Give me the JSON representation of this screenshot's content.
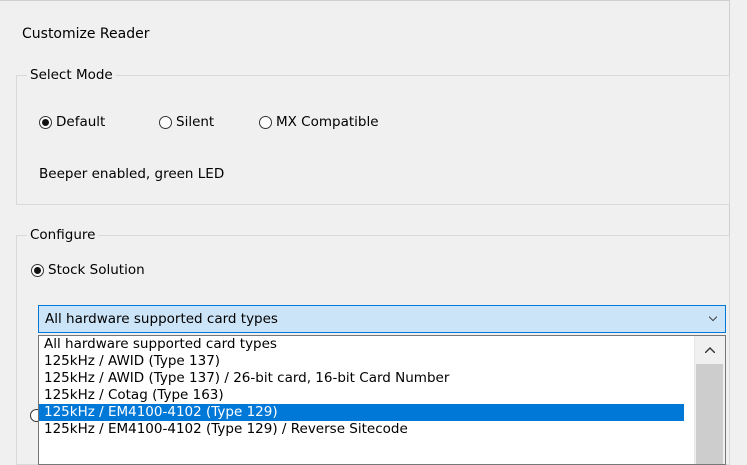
{
  "dialog": {
    "title": "Customize Reader"
  },
  "select_mode": {
    "legend": "Select Mode",
    "options": [
      {
        "label": "Default",
        "checked": true
      },
      {
        "label": "Silent",
        "checked": false
      },
      {
        "label": "MX Compatible",
        "checked": false
      }
    ],
    "description": "Beeper enabled, green LED"
  },
  "configure": {
    "legend": "Configure",
    "stock_solution_label": "Stock Solution",
    "combo_value": "All hardware supported card types",
    "dropdown_options": [
      "All hardware supported card types",
      "125kHz / AWID (Type 137)",
      "125kHz / AWID (Type 137) / 26-bit card, 16-bit Card Number",
      "125kHz / Cotag (Type 163)",
      "125kHz / EM4100-4102 (Type 129)",
      "125kHz / EM4100-4102 (Type 129) / Reverse Sitecode"
    ],
    "selected_index": 4
  },
  "colors": {
    "accent": "#0078d7",
    "combo_bg": "#cce4f7",
    "window_bg": "#f0f0f0"
  }
}
